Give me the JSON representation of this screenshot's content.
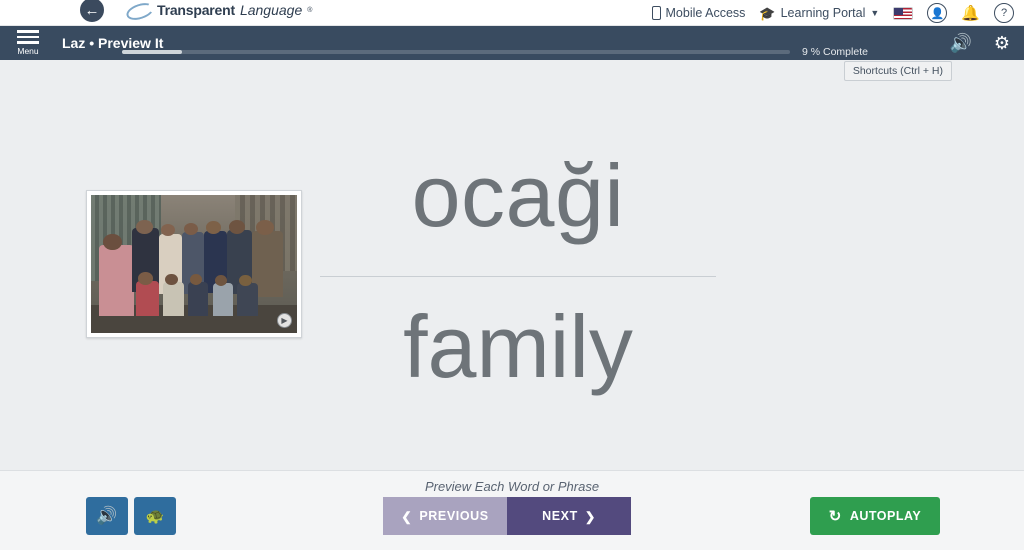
{
  "topbar": {
    "back_icon": "back-arrow-icon",
    "brand_part1": "Transparent",
    "brand_part2": "Language",
    "brand_reg": "®",
    "mobile_access": "Mobile Access",
    "learning_portal": "Learning Portal",
    "caret": "▼",
    "flag_name": "us-flag-icon",
    "account_icon": "👤",
    "bell_icon": "🔔",
    "help_icon": "?"
  },
  "navbar": {
    "menu_label": "Menu",
    "title": "Laz • Preview It",
    "progress_percent": 9,
    "progress_label": "9 % Complete",
    "speaker_icon": "🔊",
    "gear_icon": "⚙"
  },
  "tooltip": {
    "shortcuts": "Shortcuts (Ctrl + H)"
  },
  "main": {
    "image_name": "family-group-photo",
    "image_badge_icon": "play-badge-icon",
    "target_word": "ocaği",
    "translation": "family"
  },
  "bottom": {
    "instruction": "Preview Each Word or Phrase",
    "sound_icon": "🔊",
    "slow_icon": "🐢",
    "previous_label": "PREVIOUS",
    "previous_arrow": "❮",
    "next_label": "NEXT",
    "next_arrow": "❯",
    "autoplay_label": "AUTOPLAY",
    "autoplay_icon": "↻"
  },
  "colors": {
    "nav_bg": "#394b60",
    "next_btn": "#534a7e",
    "prev_btn": "#a9a3bf",
    "autoplay": "#2f9e4f",
    "sound_btn": "#2f6d9e",
    "text_gray": "#6e7479"
  }
}
